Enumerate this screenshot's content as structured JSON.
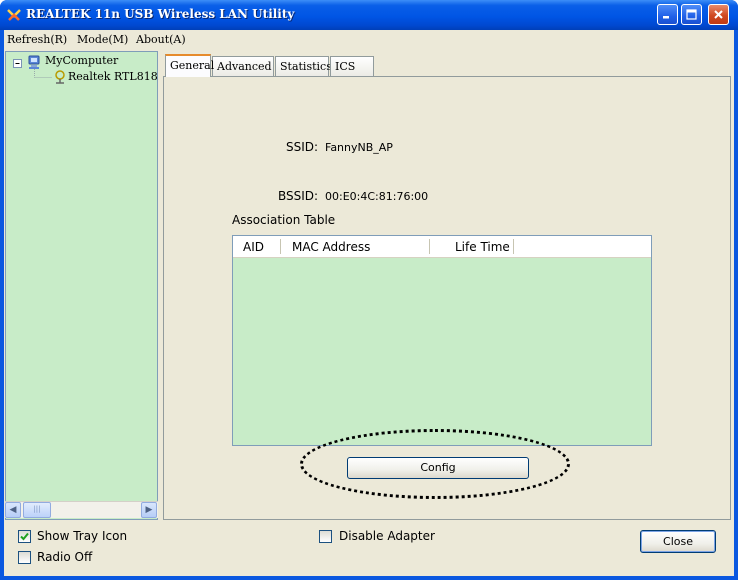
{
  "window": {
    "title": "REALTEK 11n USB Wireless LAN Utility"
  },
  "menu": {
    "items": [
      "Refresh(R)",
      "Mode(M)",
      "About(A)"
    ]
  },
  "tree": {
    "root": "MyComputer",
    "child": "Realtek RTL818"
  },
  "tabs": [
    "General",
    "Advanced",
    "Statistics",
    "ICS"
  ],
  "general": {
    "ssid_label": "SSID:",
    "ssid_value": "FannyNB_AP",
    "bssid_label": "BSSID:",
    "bssid_value": "00:E0:4C:81:76:00",
    "assoc_title": "Association Table",
    "columns": [
      "AID",
      "MAC Address",
      "Life Time"
    ],
    "config_label": "Config"
  },
  "bottom": {
    "show_tray_label": "Show Tray Icon",
    "show_tray_checked": true,
    "radio_off_label": "Radio Off",
    "radio_off_checked": false,
    "disable_adapter_label": "Disable Adapter",
    "disable_adapter_checked": false,
    "close_label": "Close"
  },
  "colors": {
    "titlebar": "#0055e5",
    "tree_bg": "#c8ecc8",
    "dialog_bg": "#ece9d8",
    "active_tab_accent": "#e68b2c"
  }
}
